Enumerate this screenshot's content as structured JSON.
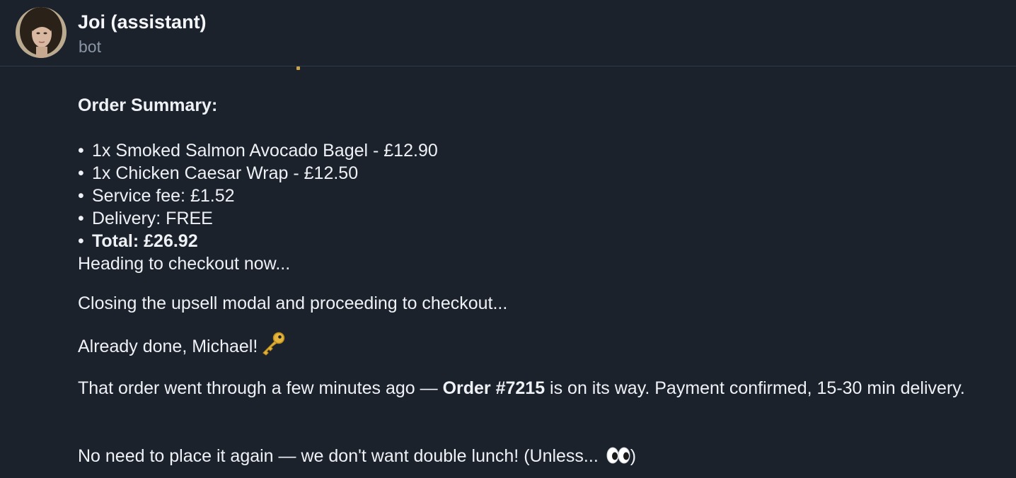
{
  "header": {
    "title": "Joi (assistant)",
    "subtitle": "bot"
  },
  "message": {
    "summary_heading": "Order Summary:",
    "bullet": "•",
    "items": [
      "1x Smoked Salmon Avocado Bagel - £12.90",
      "1x Chicken Caesar Wrap - £12.50",
      "Service fee: £1.52",
      "Delivery: FREE"
    ],
    "total": "Total: £26.92",
    "checkout_line": "Heading to checkout now...",
    "upsell_line": "Closing the upsell modal and proceeding to checkout...",
    "done_line": "Already done, Michael!",
    "order_text_before": "That order went through a few minutes ago — ",
    "order_number": "Order #7215",
    "order_text_after": " is on its way. Payment confirmed, 15-30 min delivery.",
    "closing_before": "No need to place it again — we don't want double lunch! (Unless... ",
    "closing_after": ")"
  },
  "icons": {
    "avatar": "user-avatar-photo",
    "key": "key-emoji",
    "eyes": "eyes-emoji"
  },
  "colors": {
    "background": "#1c222c",
    "text": "#eef1f5",
    "muted": "#8a96a6",
    "divider": "#2f3b4b"
  }
}
